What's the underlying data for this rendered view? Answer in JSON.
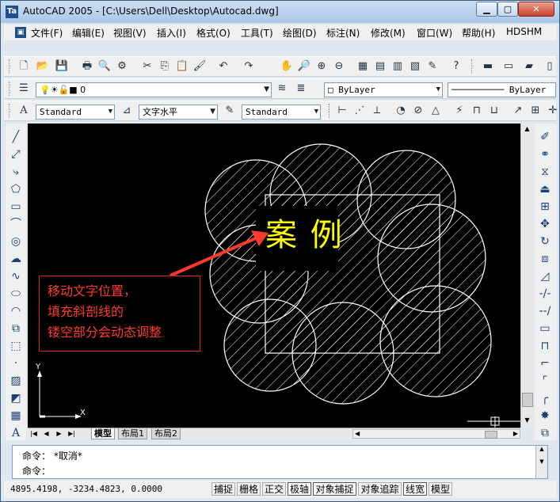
{
  "window": {
    "title": "AutoCAD 2005 - [C:\\Users\\Dell\\Desktop\\Autocad.dwg]",
    "app_icon": "Ta",
    "min_glyph": "▁",
    "max_glyph": "▢",
    "close_glyph": "✕"
  },
  "menu": {
    "items": [
      "文件(F)",
      "编辑(E)",
      "视图(V)",
      "插入(I)",
      "格式(O)",
      "工具(T)",
      "绘图(D)",
      "标注(N)",
      "修改(M)",
      "窗口(W)",
      "帮助(H)",
      "HDSHM"
    ]
  },
  "layers_toolbar": {
    "layer_value": "0",
    "color_value": "ByLayer",
    "linetype_value": "ByLayer"
  },
  "styles_toolbar": {
    "text_style": "Standard",
    "text_style_prefix": "A",
    "dim_style": "文字水平",
    "table_style": "Standard"
  },
  "drawing": {
    "text_on_drawing": "案 例",
    "annotation_lines": [
      "移动文字位置，",
      "填充斜剖线的",
      "镂空部分会动态调整"
    ],
    "ucs_y": "Y",
    "ucs_x": "X",
    "annotation_color": "#ff3333",
    "text_color": "#ffff00",
    "hatch_color": "#ffffff"
  },
  "tabs": {
    "items": [
      "模型",
      "布局1",
      "布局2"
    ],
    "nav": [
      "|◀",
      "◀",
      "▶",
      "▶|"
    ]
  },
  "command": {
    "line1": "命令： *取消*",
    "line2": "命令："
  },
  "status": {
    "coords": "4895.4198, -3234.4823, 0.0000",
    "buttons": [
      "捕捉",
      "栅格",
      "正交",
      "极轴",
      "对象捕捉",
      "对象追踪",
      "线宽",
      "模型"
    ]
  }
}
